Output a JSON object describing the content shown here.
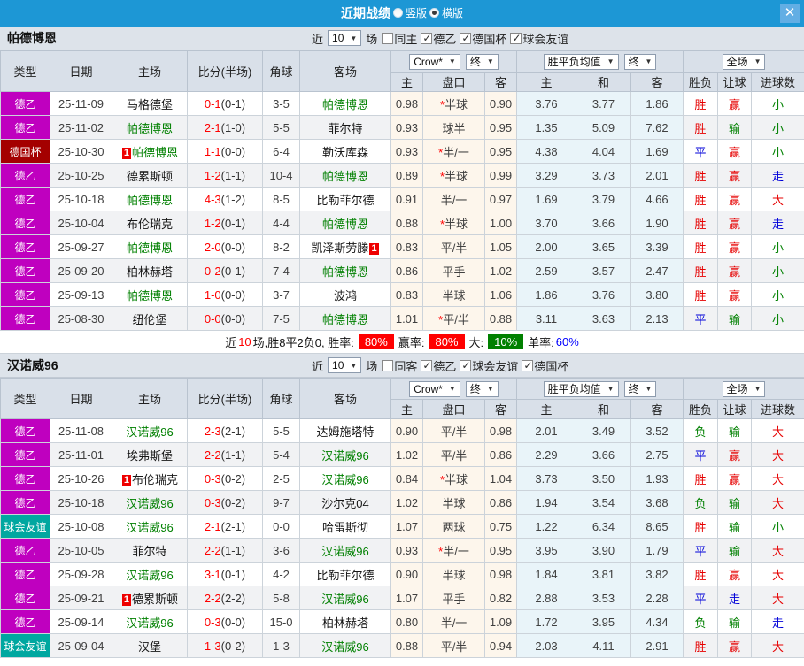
{
  "titlebar": {
    "title": "近期战绩",
    "radios": [
      {
        "label": "竖版",
        "checked": false
      },
      {
        "label": "横版",
        "checked": true
      }
    ],
    "close_label": "✕"
  },
  "colors": {
    "titlebar_blue": "#1d97d5",
    "header_gray": "#d9e0e9",
    "odds_cream": "#fdf6ec",
    "avg_blue": "#e9f4f9"
  },
  "type_colors": {
    "德乙": "#bf00bf",
    "德国杯": "#a40000",
    "球会友谊": "#00a7a0"
  },
  "table_header": {
    "cols": [
      "类型",
      "日期",
      "主场",
      "比分(半场)",
      "角球",
      "客场"
    ],
    "odds_select": "Crow*",
    "final_select": "终",
    "avg_select": "胜平负均值",
    "final_select2": "终",
    "full_select": "全场",
    "sub": [
      "主",
      "盘口",
      "客",
      "主",
      "和",
      "客",
      "胜负",
      "让球",
      "进球数"
    ]
  },
  "sections": [
    {
      "team": "帕德博恩",
      "filters": {
        "near": "近",
        "count": "10",
        "unit": "场",
        "checkboxes": [
          {
            "label": "同主",
            "checked": false
          },
          {
            "label": "德乙",
            "checked": true
          },
          {
            "label": "德国杯",
            "checked": true
          },
          {
            "label": "球会友谊",
            "checked": true
          }
        ]
      },
      "rows": [
        {
          "type": "德乙",
          "date": "25-11-09",
          "home": "马格德堡",
          "hg": false,
          "hc": 0,
          "score": "0-1",
          "half": "(0-1)",
          "corner": "3-5",
          "away": "帕德博恩",
          "ag": true,
          "ac": 0,
          "o": [
            "0.98",
            "*半球",
            "0.90"
          ],
          "a": [
            "3.76",
            "3.77",
            "1.86"
          ],
          "res": [
            [
              "胜",
              "r"
            ],
            [
              "赢",
              "r"
            ],
            [
              "小",
              "g"
            ]
          ]
        },
        {
          "type": "德乙",
          "date": "25-11-02",
          "home": "帕德博恩",
          "hg": true,
          "hc": 0,
          "score": "2-1",
          "half": "(1-0)",
          "corner": "5-5",
          "away": "菲尔特",
          "ag": false,
          "ac": 0,
          "o": [
            "0.93",
            "球半",
            "0.95"
          ],
          "a": [
            "1.35",
            "5.09",
            "7.62"
          ],
          "res": [
            [
              "胜",
              "r"
            ],
            [
              "输",
              "g"
            ],
            [
              "小",
              "g"
            ]
          ]
        },
        {
          "type": "德国杯",
          "date": "25-10-30",
          "home": "帕德博恩",
          "hg": true,
          "hc": 1,
          "score": "1-1",
          "half": "(0-0)",
          "corner": "6-4",
          "away": "勒沃库森",
          "ag": false,
          "ac": 0,
          "o": [
            "0.93",
            "*半/一",
            "0.95"
          ],
          "a": [
            "4.38",
            "4.04",
            "1.69"
          ],
          "res": [
            [
              "平",
              "b"
            ],
            [
              "赢",
              "r"
            ],
            [
              "小",
              "g"
            ]
          ]
        },
        {
          "type": "德乙",
          "date": "25-10-25",
          "home": "德累斯顿",
          "hg": false,
          "hc": 0,
          "score": "1-2",
          "half": "(1-1)",
          "corner": "10-4",
          "away": "帕德博恩",
          "ag": true,
          "ac": 0,
          "o": [
            "0.89",
            "*半球",
            "0.99"
          ],
          "a": [
            "3.29",
            "3.73",
            "2.01"
          ],
          "res": [
            [
              "胜",
              "r"
            ],
            [
              "赢",
              "r"
            ],
            [
              "走",
              "b"
            ]
          ]
        },
        {
          "type": "德乙",
          "date": "25-10-18",
          "home": "帕德博恩",
          "hg": true,
          "hc": 0,
          "score": "4-3",
          "half": "(1-2)",
          "corner": "8-5",
          "away": "比勒菲尔德",
          "ag": false,
          "ac": 0,
          "o": [
            "0.91",
            "半/一",
            "0.97"
          ],
          "a": [
            "1.69",
            "3.79",
            "4.66"
          ],
          "res": [
            [
              "胜",
              "r"
            ],
            [
              "赢",
              "r"
            ],
            [
              "大",
              "r"
            ]
          ]
        },
        {
          "type": "德乙",
          "date": "25-10-04",
          "home": "布伦瑞克",
          "hg": false,
          "hc": 0,
          "score": "1-2",
          "half": "(0-1)",
          "corner": "4-4",
          "away": "帕德博恩",
          "ag": true,
          "ac": 0,
          "o": [
            "0.88",
            "*半球",
            "1.00"
          ],
          "a": [
            "3.70",
            "3.66",
            "1.90"
          ],
          "res": [
            [
              "胜",
              "r"
            ],
            [
              "赢",
              "r"
            ],
            [
              "走",
              "b"
            ]
          ]
        },
        {
          "type": "德乙",
          "date": "25-09-27",
          "home": "帕德博恩",
          "hg": true,
          "hc": 0,
          "score": "2-0",
          "half": "(0-0)",
          "corner": "8-2",
          "away": "凯泽斯劳滕",
          "ag": false,
          "ac": 1,
          "o": [
            "0.83",
            "平/半",
            "1.05"
          ],
          "a": [
            "2.00",
            "3.65",
            "3.39"
          ],
          "res": [
            [
              "胜",
              "r"
            ],
            [
              "赢",
              "r"
            ],
            [
              "小",
              "g"
            ]
          ]
        },
        {
          "type": "德乙",
          "date": "25-09-20",
          "home": "柏林赫塔",
          "hg": false,
          "hc": 0,
          "score": "0-2",
          "half": "(0-1)",
          "corner": "7-4",
          "away": "帕德博恩",
          "ag": true,
          "ac": 0,
          "o": [
            "0.86",
            "平手",
            "1.02"
          ],
          "a": [
            "2.59",
            "3.57",
            "2.47"
          ],
          "res": [
            [
              "胜",
              "r"
            ],
            [
              "赢",
              "r"
            ],
            [
              "小",
              "g"
            ]
          ]
        },
        {
          "type": "德乙",
          "date": "25-09-13",
          "home": "帕德博恩",
          "hg": true,
          "hc": 0,
          "score": "1-0",
          "half": "(0-0)",
          "corner": "3-7",
          "away": "波鸿",
          "ag": false,
          "ac": 0,
          "o": [
            "0.83",
            "半球",
            "1.06"
          ],
          "a": [
            "1.86",
            "3.76",
            "3.80"
          ],
          "res": [
            [
              "胜",
              "r"
            ],
            [
              "赢",
              "r"
            ],
            [
              "小",
              "g"
            ]
          ]
        },
        {
          "type": "德乙",
          "date": "25-08-30",
          "home": "纽伦堡",
          "hg": false,
          "hc": 0,
          "score": "0-0",
          "half": "(0-0)",
          "corner": "7-5",
          "away": "帕德博恩",
          "ag": true,
          "ac": 0,
          "o": [
            "1.01",
            "*平/半",
            "0.88"
          ],
          "a": [
            "3.11",
            "3.63",
            "2.13"
          ],
          "res": [
            [
              "平",
              "b"
            ],
            [
              "输",
              "g"
            ],
            [
              "小",
              "g"
            ]
          ]
        }
      ],
      "summary": [
        [
          "近",
          "t"
        ],
        [
          "10",
          "rt"
        ],
        [
          "场,胜8平2负0, 胜率:",
          "t"
        ],
        [
          "80%",
          "rb"
        ],
        [
          "赢率:",
          "t"
        ],
        [
          "80%",
          "rb"
        ],
        [
          "大:",
          "t"
        ],
        [
          "10%",
          "gb"
        ],
        [
          "单率:",
          "t"
        ],
        [
          "60%",
          "bt"
        ]
      ]
    },
    {
      "team": "汉诺威96",
      "filters": {
        "near": "近",
        "count": "10",
        "unit": "场",
        "checkboxes": [
          {
            "label": "同客",
            "checked": false
          },
          {
            "label": "德乙",
            "checked": true
          },
          {
            "label": "球会友谊",
            "checked": true
          },
          {
            "label": "德国杯",
            "checked": true
          }
        ]
      },
      "rows": [
        {
          "type": "德乙",
          "date": "25-11-08",
          "home": "汉诺威96",
          "hg": true,
          "hc": 0,
          "score": "2-3",
          "half": "(2-1)",
          "corner": "5-5",
          "away": "达姆施塔特",
          "ag": false,
          "ac": 0,
          "o": [
            "0.90",
            "平/半",
            "0.98"
          ],
          "a": [
            "2.01",
            "3.49",
            "3.52"
          ],
          "res": [
            [
              "负",
              "g"
            ],
            [
              "输",
              "g"
            ],
            [
              "大",
              "r"
            ]
          ]
        },
        {
          "type": "德乙",
          "date": "25-11-01",
          "home": "埃弗斯堡",
          "hg": false,
          "hc": 0,
          "score": "2-2",
          "half": "(1-1)",
          "corner": "5-4",
          "away": "汉诺威96",
          "ag": true,
          "ac": 0,
          "o": [
            "1.02",
            "平/半",
            "0.86"
          ],
          "a": [
            "2.29",
            "3.66",
            "2.75"
          ],
          "res": [
            [
              "平",
              "b"
            ],
            [
              "赢",
              "r"
            ],
            [
              "大",
              "r"
            ]
          ]
        },
        {
          "type": "德乙",
          "date": "25-10-26",
          "home": "布伦瑞克",
          "hg": false,
          "hc": 1,
          "score": "0-3",
          "half": "(0-2)",
          "corner": "2-5",
          "away": "汉诺威96",
          "ag": true,
          "ac": 0,
          "o": [
            "0.84",
            "*半球",
            "1.04"
          ],
          "a": [
            "3.73",
            "3.50",
            "1.93"
          ],
          "res": [
            [
              "胜",
              "r"
            ],
            [
              "赢",
              "r"
            ],
            [
              "大",
              "r"
            ]
          ]
        },
        {
          "type": "德乙",
          "date": "25-10-18",
          "home": "汉诺威96",
          "hg": true,
          "hc": 0,
          "score": "0-3",
          "half": "(0-2)",
          "corner": "9-7",
          "away": "沙尔克04",
          "ag": false,
          "ac": 0,
          "o": [
            "1.02",
            "半球",
            "0.86"
          ],
          "a": [
            "1.94",
            "3.54",
            "3.68"
          ],
          "res": [
            [
              "负",
              "g"
            ],
            [
              "输",
              "g"
            ],
            [
              "大",
              "r"
            ]
          ]
        },
        {
          "type": "球会友谊",
          "date": "25-10-08",
          "home": "汉诺威96",
          "hg": true,
          "hc": 0,
          "score": "2-1",
          "half": "(2-1)",
          "corner": "0-0",
          "away": "哈雷斯彻",
          "ag": false,
          "ac": 0,
          "o": [
            "1.07",
            "两球",
            "0.75"
          ],
          "a": [
            "1.22",
            "6.34",
            "8.65"
          ],
          "res": [
            [
              "胜",
              "r"
            ],
            [
              "输",
              "g"
            ],
            [
              "小",
              "g"
            ]
          ]
        },
        {
          "type": "德乙",
          "date": "25-10-05",
          "home": "菲尔特",
          "hg": false,
          "hc": 0,
          "score": "2-2",
          "half": "(1-1)",
          "corner": "3-6",
          "away": "汉诺威96",
          "ag": true,
          "ac": 0,
          "o": [
            "0.93",
            "*半/一",
            "0.95"
          ],
          "a": [
            "3.95",
            "3.90",
            "1.79"
          ],
          "res": [
            [
              "平",
              "b"
            ],
            [
              "输",
              "g"
            ],
            [
              "大",
              "r"
            ]
          ]
        },
        {
          "type": "德乙",
          "date": "25-09-28",
          "home": "汉诺威96",
          "hg": true,
          "hc": 0,
          "score": "3-1",
          "half": "(0-1)",
          "corner": "4-2",
          "away": "比勒菲尔德",
          "ag": false,
          "ac": 0,
          "o": [
            "0.90",
            "半球",
            "0.98"
          ],
          "a": [
            "1.84",
            "3.81",
            "3.82"
          ],
          "res": [
            [
              "胜",
              "r"
            ],
            [
              "赢",
              "r"
            ],
            [
              "大",
              "r"
            ]
          ]
        },
        {
          "type": "德乙",
          "date": "25-09-21",
          "home": "德累斯顿",
          "hg": false,
          "hc": 1,
          "score": "2-2",
          "half": "(2-2)",
          "corner": "5-8",
          "away": "汉诺威96",
          "ag": true,
          "ac": 0,
          "o": [
            "1.07",
            "平手",
            "0.82"
          ],
          "a": [
            "2.88",
            "3.53",
            "2.28"
          ],
          "res": [
            [
              "平",
              "b"
            ],
            [
              "走",
              "b"
            ],
            [
              "大",
              "r"
            ]
          ]
        },
        {
          "type": "德乙",
          "date": "25-09-14",
          "home": "汉诺威96",
          "hg": true,
          "hc": 0,
          "score": "0-3",
          "half": "(0-0)",
          "corner": "15-0",
          "away": "柏林赫塔",
          "ag": false,
          "ac": 0,
          "o": [
            "0.80",
            "半/一",
            "1.09"
          ],
          "a": [
            "1.72",
            "3.95",
            "4.34"
          ],
          "res": [
            [
              "负",
              "g"
            ],
            [
              "输",
              "g"
            ],
            [
              "走",
              "b"
            ]
          ]
        },
        {
          "type": "球会友谊",
          "date": "25-09-04",
          "home": "汉堡",
          "hg": false,
          "hc": 0,
          "score": "1-3",
          "half": "(0-2)",
          "corner": "1-3",
          "away": "汉诺威96",
          "ag": true,
          "ac": 0,
          "o": [
            "0.88",
            "平/半",
            "0.94"
          ],
          "a": [
            "2.03",
            "4.11",
            "2.91"
          ],
          "res": [
            [
              "胜",
              "r"
            ],
            [
              "赢",
              "r"
            ],
            [
              "大",
              "r"
            ]
          ]
        }
      ],
      "summary": null
    }
  ]
}
